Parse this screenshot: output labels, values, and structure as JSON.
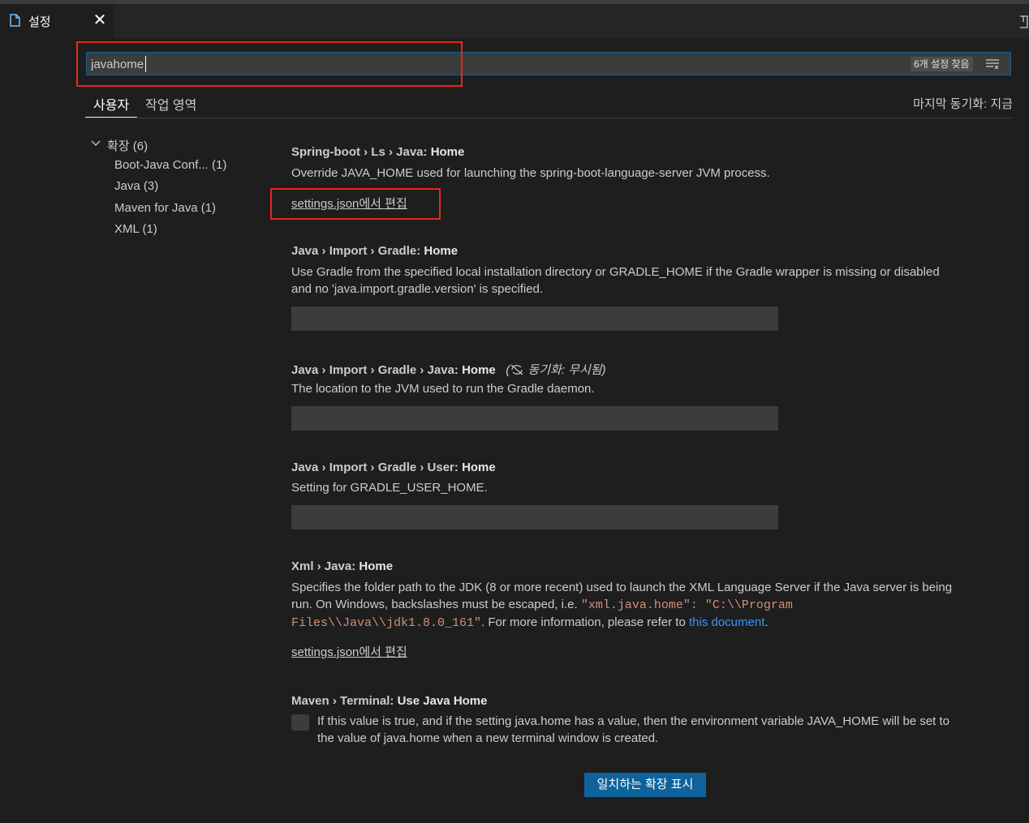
{
  "tab": {
    "label": "설정",
    "close": "✕"
  },
  "search": {
    "value": "javahome",
    "count_label": "6개 설정 찾음"
  },
  "scopes": {
    "user": "사용자",
    "workspace": "작업 영역",
    "sync_status": "마지막 동기화: 지금"
  },
  "toc": {
    "group": "확장 (6)",
    "items": [
      "Boot-Java Conf... (1)",
      "Java (3)",
      "Maven for Java (1)",
      "XML (1)"
    ]
  },
  "settings": [
    {
      "category": "Spring-boot › Ls › Java: ",
      "name": "Home",
      "description": "Override JAVA_HOME used for launching the spring-boot-language-server JVM process.",
      "edit_link": "settings.json에서 편집"
    },
    {
      "category": "Java › Import › Gradle: ",
      "name": "Home",
      "description_line1": "Use Gradle from the specified local installation directory or GRADLE_HOME if the Gradle wrapper is missing or disabled",
      "description_line2": "and no 'java.import.gradle.version' is specified."
    },
    {
      "category": "Java › Import › Gradle › Java: ",
      "name": "Home",
      "sync_ignored": "동기화: 무시됨)",
      "sync_open": "(",
      "description": "The location to the JVM used to run the Gradle daemon."
    },
    {
      "category": "Java › Import › Gradle › User: ",
      "name": "Home",
      "description": "Setting for GRADLE_USER_HOME."
    },
    {
      "category": "Xml › Java: ",
      "name": "Home",
      "description_line1": "Specifies the folder path to the JDK (8 or more recent) used to launch the XML Language Server if the Java server is being",
      "description_line2_prefix": "run. On Windows, backslashes must be escaped, i.e. ",
      "code_line2": "\"xml.java.home\": \"C:\\\\Program",
      "code_line3": "Files\\\\Java\\\\jdk1.8.0_161\"",
      "description_line3_suffix": ". For more information, please refer to ",
      "doc_link": "this document",
      "period": ".",
      "edit_link": "settings.json에서 편집"
    },
    {
      "category": "Maven › Terminal: ",
      "name": "Use Java Home",
      "description_line1": "If this value is true, and if the setting java.home has a value, then the environment variable JAVA_HOME will be set to",
      "description_line2": "the value of java.home when a new terminal window is created."
    }
  ],
  "extensions_button": "일치하는 확장 표시"
}
